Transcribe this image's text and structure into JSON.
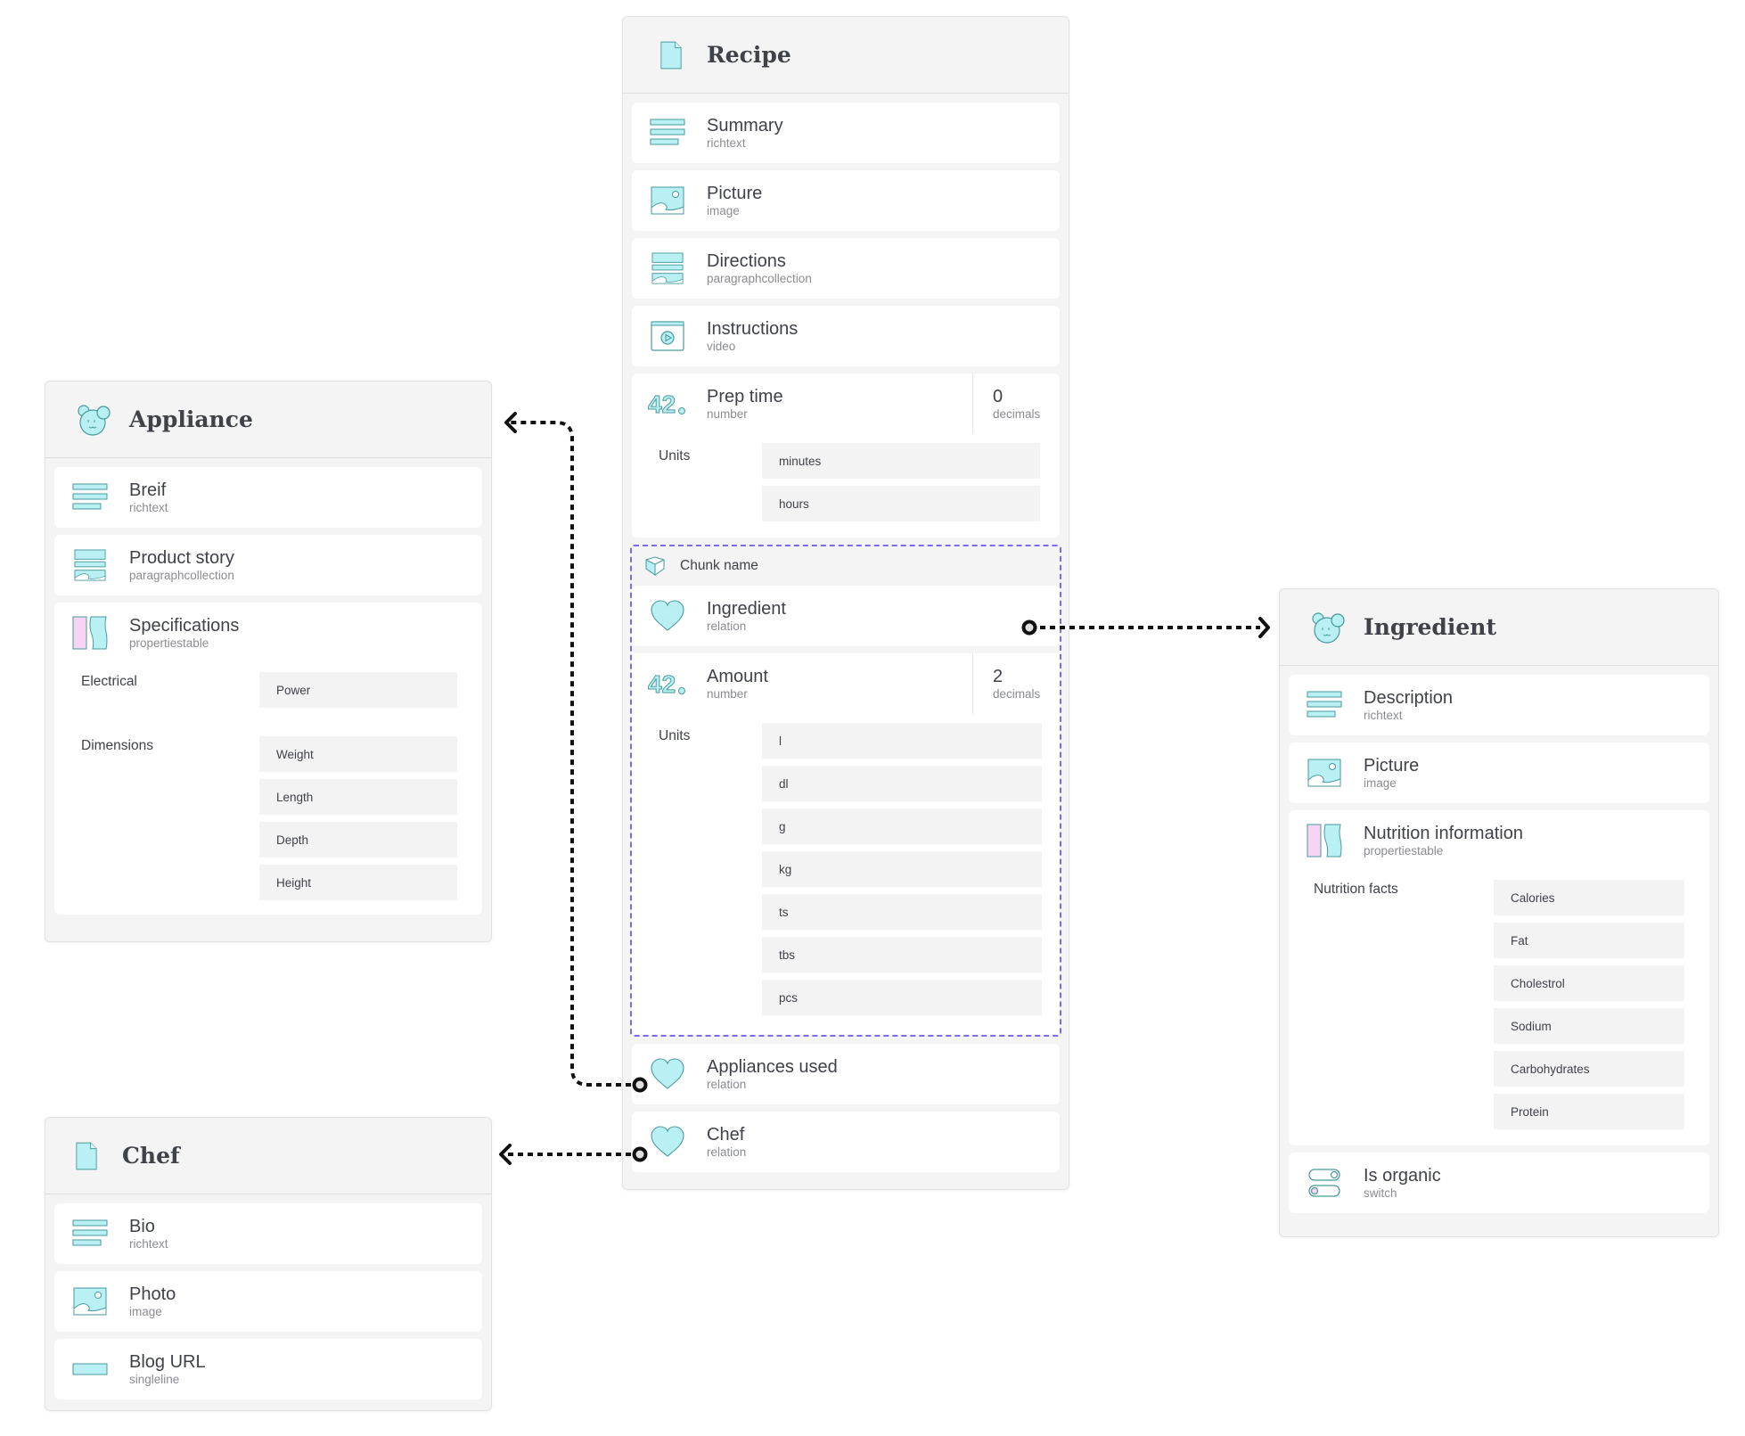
{
  "colors": {
    "icon_fill": "#b8f0f4",
    "icon_stroke": "#4a9a9e",
    "icon_pink": "#f7d4f4",
    "chunk_border": "#7a6af0",
    "connector": "#111111"
  },
  "recipe": {
    "title": "Recipe",
    "icon": "document-icon",
    "fields": [
      {
        "name": "Summary",
        "type": "richtext",
        "icon": "richtext-icon"
      },
      {
        "name": "Picture",
        "type": "image",
        "icon": "image-icon"
      },
      {
        "name": "Directions",
        "type": "paragraphcollection",
        "icon": "paragraphcollection-icon"
      },
      {
        "name": "Instructions",
        "type": "video",
        "icon": "video-icon"
      },
      {
        "name": "Prep time",
        "type": "number",
        "icon": "number-icon",
        "decimals": "0",
        "decimals_label": "decimals",
        "units_label": "Units",
        "units": [
          "minutes",
          "hours"
        ]
      }
    ],
    "chunk": {
      "name": "Chunk name",
      "icon": "chunk-icon",
      "fields": [
        {
          "name": "Ingredient",
          "type": "relation",
          "icon": "relation-icon"
        },
        {
          "name": "Amount",
          "type": "number",
          "icon": "number-icon",
          "decimals": "2",
          "decimals_label": "decimals",
          "units_label": "Units",
          "units": [
            "l",
            "dl",
            "g",
            "kg",
            "ts",
            "tbs",
            "pcs"
          ]
        }
      ]
    },
    "after_chunk": [
      {
        "name": "Appliances used",
        "type": "relation",
        "icon": "relation-icon"
      },
      {
        "name": "Chef",
        "type": "relation",
        "icon": "relation-icon"
      }
    ]
  },
  "appliance": {
    "title": "Appliance",
    "icon": "bear-icon",
    "fields": [
      {
        "name": "Breif",
        "type": "richtext",
        "icon": "richtext-icon"
      },
      {
        "name": "Product story",
        "type": "paragraphcollection",
        "icon": "paragraphcollection-icon"
      },
      {
        "name": "Specifications",
        "type": "propertiestable",
        "icon": "propertiestable-icon",
        "groups": [
          {
            "label": "Electrical",
            "values": [
              "Power"
            ]
          },
          {
            "label": "Dimensions",
            "values": [
              "Weight",
              "Length",
              "Depth",
              "Height"
            ]
          }
        ]
      }
    ]
  },
  "chef": {
    "title": "Chef",
    "icon": "document-icon",
    "fields": [
      {
        "name": "Bio",
        "type": "richtext",
        "icon": "richtext-icon"
      },
      {
        "name": "Photo",
        "type": "image",
        "icon": "image-icon"
      },
      {
        "name": "Blog URL",
        "type": "singleline",
        "icon": "singleline-icon"
      }
    ]
  },
  "ingredient": {
    "title": "Ingredient",
    "icon": "bear-icon",
    "fields": [
      {
        "name": "Description",
        "type": "richtext",
        "icon": "richtext-icon"
      },
      {
        "name": "Picture",
        "type": "image",
        "icon": "image-icon"
      },
      {
        "name": "Nutrition information",
        "type": "propertiestable",
        "icon": "propertiestable-icon",
        "groups": [
          {
            "label": "Nutrition facts",
            "values": [
              "Calories",
              "Fat",
              "Cholestrol",
              "Sodium",
              "Carbohydrates",
              "Protein"
            ]
          }
        ]
      },
      {
        "name": "Is organic",
        "type": "switch",
        "icon": "switch-icon"
      }
    ]
  },
  "connections": [
    {
      "from": "Recipe.Ingredient",
      "to": "Ingredient"
    },
    {
      "from": "Recipe.Appliances used",
      "to": "Appliance"
    },
    {
      "from": "Recipe.Chef",
      "to": "Chef"
    }
  ]
}
